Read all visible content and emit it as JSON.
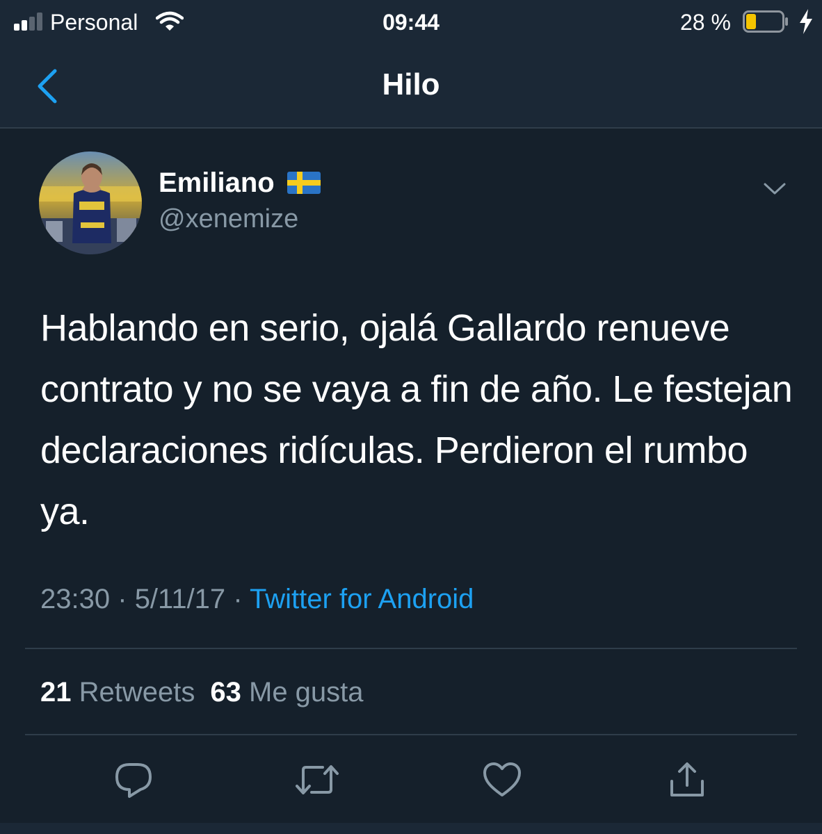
{
  "status_bar": {
    "carrier": "Personal",
    "time": "09:44",
    "battery_percent": "28 %",
    "battery_level": 0.28,
    "signal_bars_filled": 2,
    "signal_bars_total": 4,
    "icons": [
      "signal-icon",
      "wifi-icon",
      "battery-icon",
      "charging-icon"
    ]
  },
  "nav": {
    "title": "Hilo",
    "back_icon": "chevron-left-icon"
  },
  "tweet": {
    "display_name": "Emiliano",
    "flag_icon": "sweden-flag-icon",
    "handle": "@xenemize",
    "menu_icon": "chevron-down-icon",
    "text": "Hablando en serio, ojalá Gallardo renueve contrato y no se vaya a fin de año. Le festejan declaraciones ridículas. Perdieron el rumbo ya.",
    "time": "23:30",
    "separator_1": "·",
    "date": "5/11/17",
    "separator_2": "·",
    "source": "Twitter for Android",
    "retweets_count": "21",
    "retweets_label": "Retweets",
    "likes_count": "63",
    "likes_label": "Me gusta"
  },
  "actions": {
    "icons": [
      "reply-icon",
      "retweet-icon",
      "like-icon",
      "share-icon"
    ]
  },
  "colors": {
    "background": "#15202b",
    "bar": "#1b2836",
    "accent": "#1da1f2",
    "muted": "#8899a6",
    "divider": "#2f3d4a",
    "battery_fill": "#f5c400"
  }
}
